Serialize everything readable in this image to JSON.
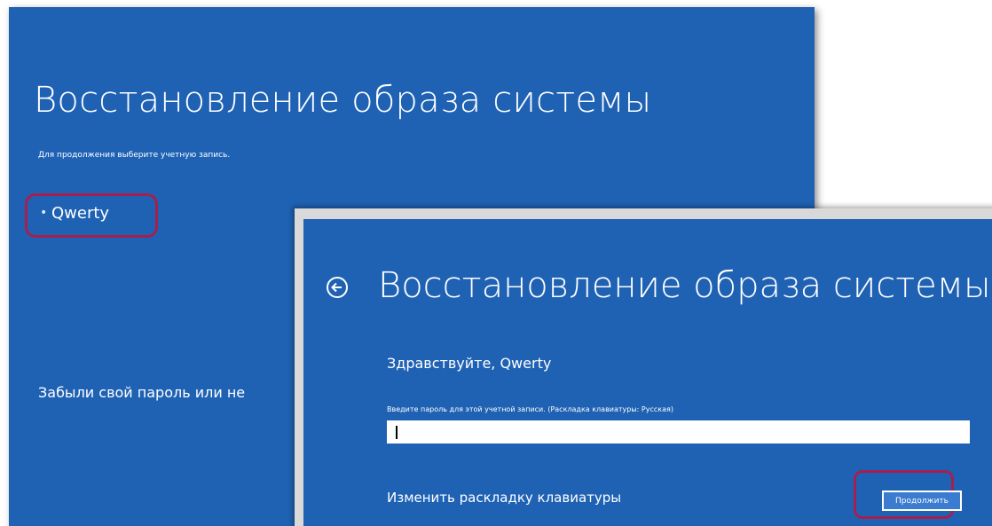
{
  "back_screen": {
    "title": "Восстановление образа системы",
    "subtitle": "Для продолжения выберите учетную запись.",
    "account": {
      "bullet": "•",
      "name": "Qwerty"
    },
    "forgot_text": "Забыли свой пароль или не"
  },
  "front_screen": {
    "title": "Восстановление образа системы",
    "greeting": "Здравствуйте, Qwerty",
    "password_label": "Введите пароль для этой учетной записи. (Раскладка клавиатуры: Русская)",
    "password_value": "",
    "change_layout": "Изменить раскладку клавиатуры",
    "continue_label": "Продолжить"
  },
  "colors": {
    "background_blue": "#1f62b4",
    "highlight": "#a51f4f",
    "button_blue": "#3b7bd0"
  },
  "icons": {
    "back": "back-arrow-circle-icon"
  }
}
